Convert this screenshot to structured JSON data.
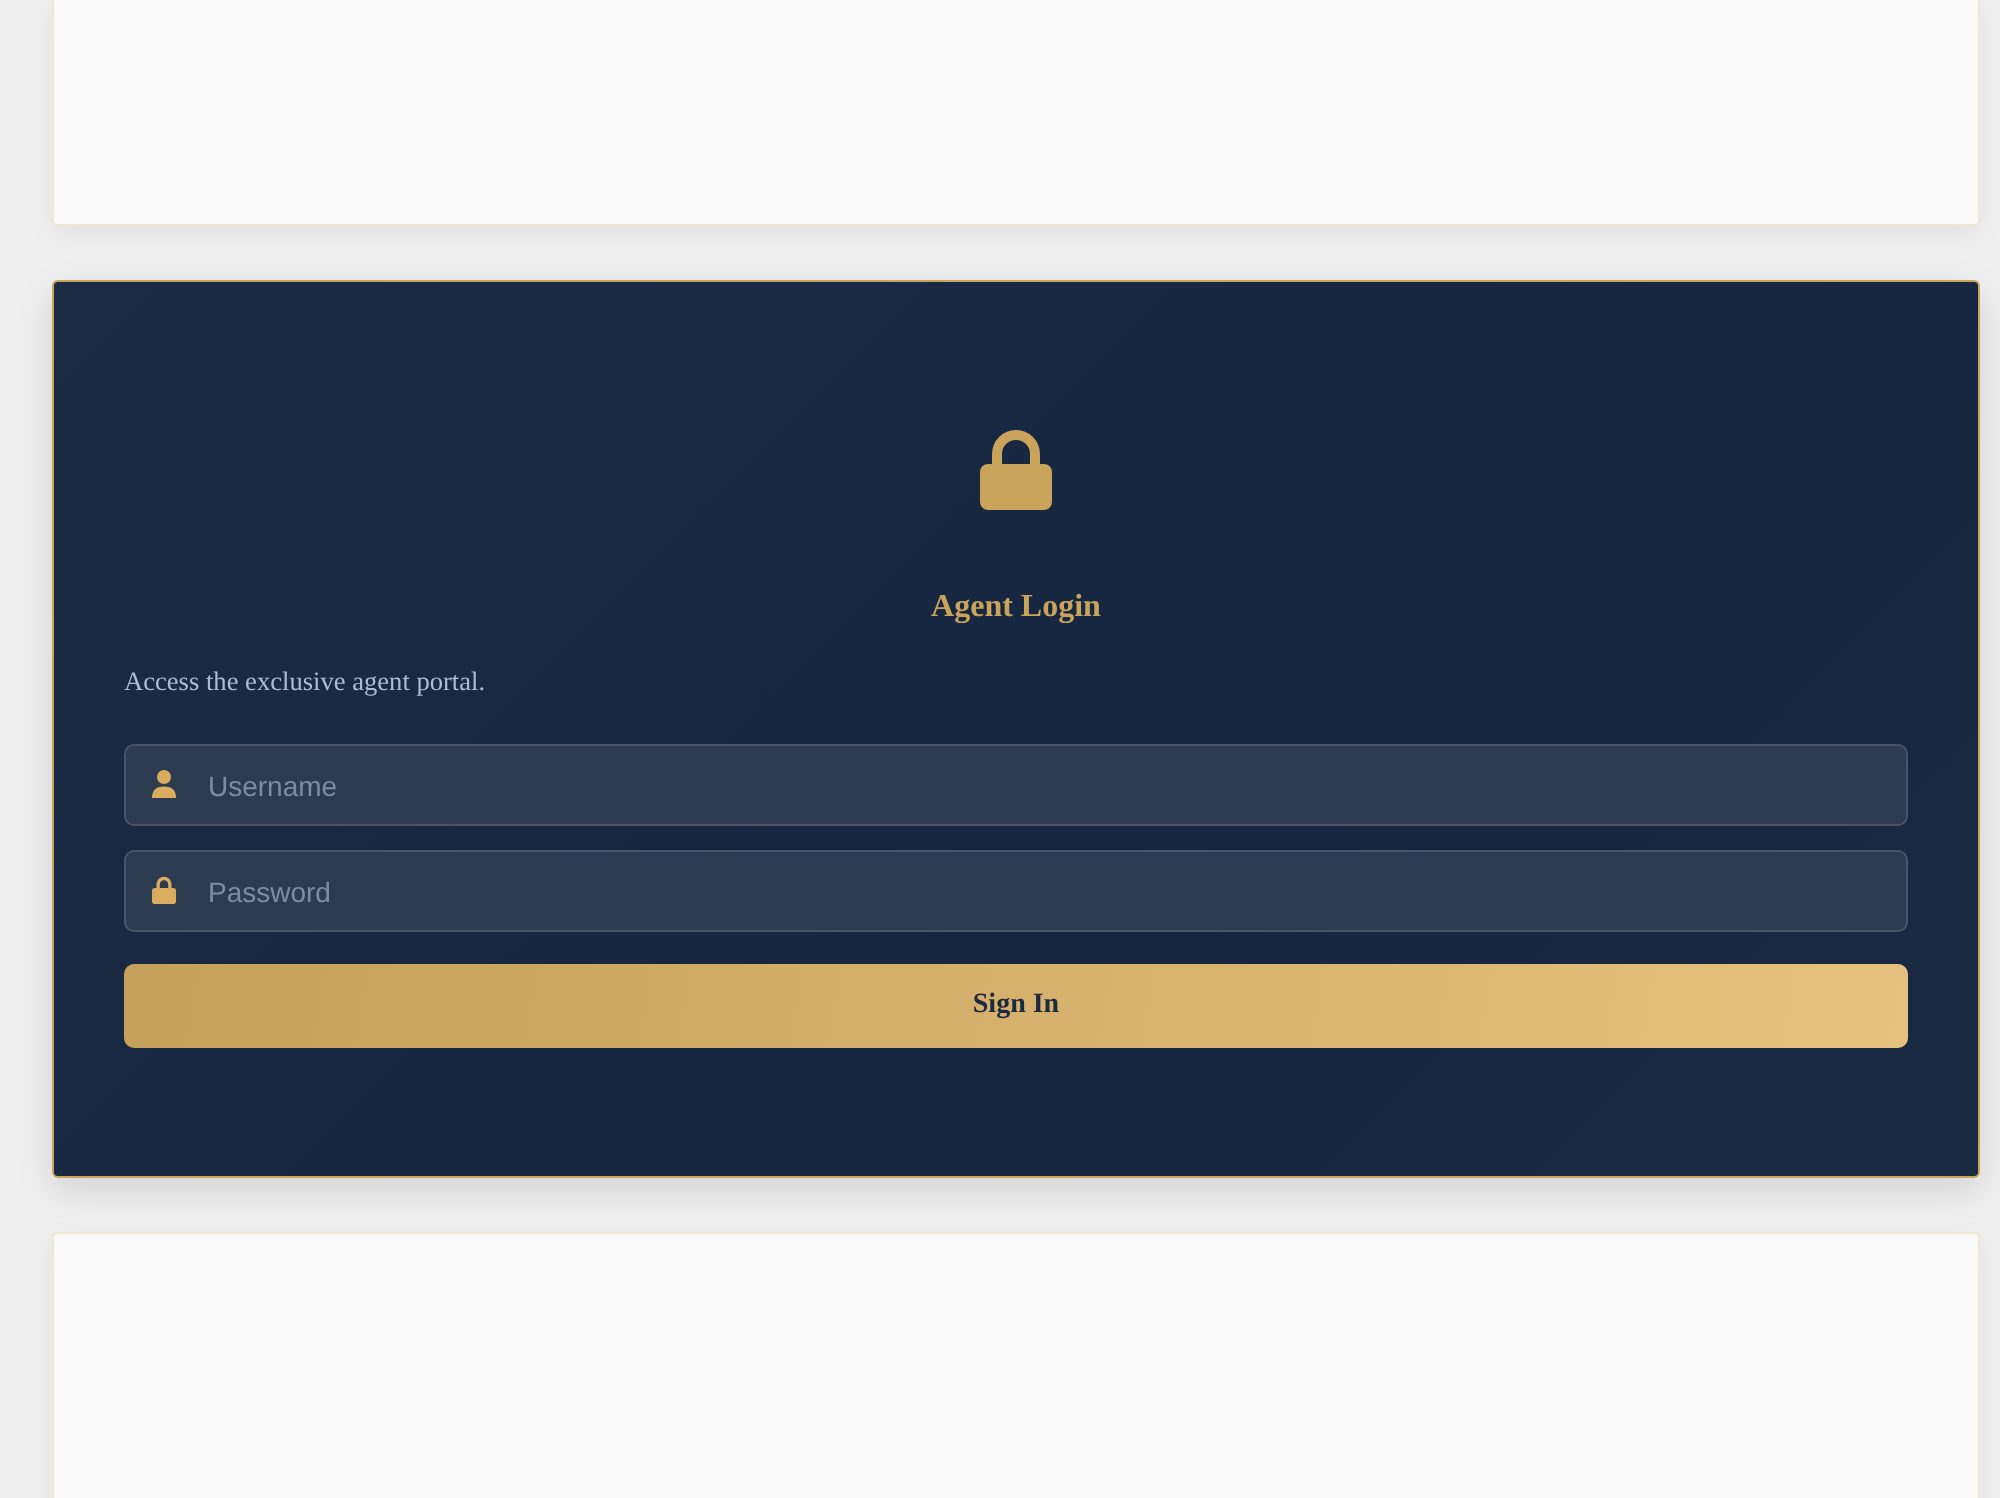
{
  "login": {
    "title": "Agent Login",
    "description": "Access the exclusive agent portal.",
    "fields": [
      {
        "kind": "username",
        "placeholder": "Username"
      },
      {
        "kind": "password",
        "placeholder": "Password"
      }
    ],
    "button": "Sign In"
  }
}
